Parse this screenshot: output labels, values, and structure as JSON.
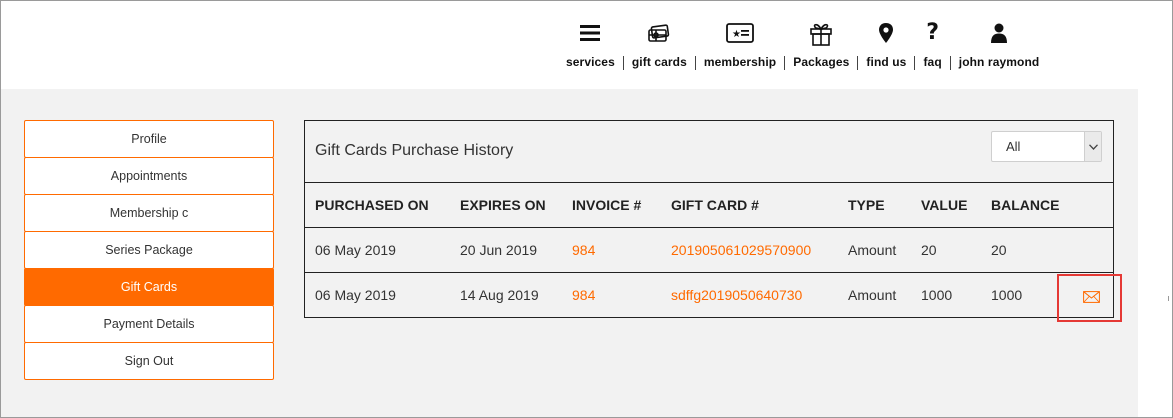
{
  "nav": {
    "items": [
      {
        "label": "services",
        "icon": "menu-icon"
      },
      {
        "label": "gift cards",
        "icon": "gift-card-icon"
      },
      {
        "label": "membership",
        "icon": "membership-card-icon"
      },
      {
        "label": "Packages",
        "icon": "gift-box-icon"
      },
      {
        "label": "find us",
        "icon": "map-pin-icon"
      },
      {
        "label": "faq",
        "icon": "question-icon"
      },
      {
        "label": "john raymond",
        "icon": "user-icon"
      }
    ]
  },
  "sidebar": {
    "items": [
      {
        "label": "Profile",
        "active": false
      },
      {
        "label": "Appointments",
        "active": false
      },
      {
        "label": "Membership c",
        "active": false
      },
      {
        "label": "Series Package",
        "active": false
      },
      {
        "label": "Gift Cards",
        "active": true
      },
      {
        "label": "Payment Details",
        "active": false
      },
      {
        "label": "Sign Out",
        "active": false
      }
    ]
  },
  "panel": {
    "title": "Gift Cards Purchase History",
    "filter": {
      "selected": "All"
    }
  },
  "table": {
    "headers": [
      "PURCHASED ON",
      "EXPIRES ON",
      "INVOICE #",
      "GIFT CARD #",
      "TYPE",
      "VALUE",
      "BALANCE"
    ],
    "rows": [
      {
        "purchased": "06 May 2019",
        "expires": "20 Jun 2019",
        "invoice": "984",
        "card": "201905061029570900",
        "type": "Amount",
        "value": "20",
        "balance": "20",
        "has_mail": false
      },
      {
        "purchased": "06 May 2019",
        "expires": "14 Aug 2019",
        "invoice": "984",
        "card": "sdffg2019050640730",
        "type": "Amount",
        "value": "1000",
        "balance": "1000",
        "has_mail": true
      }
    ]
  },
  "colors": {
    "accent": "#ff6a00",
    "highlight": "#e53935",
    "background": "#f2f2f2"
  }
}
